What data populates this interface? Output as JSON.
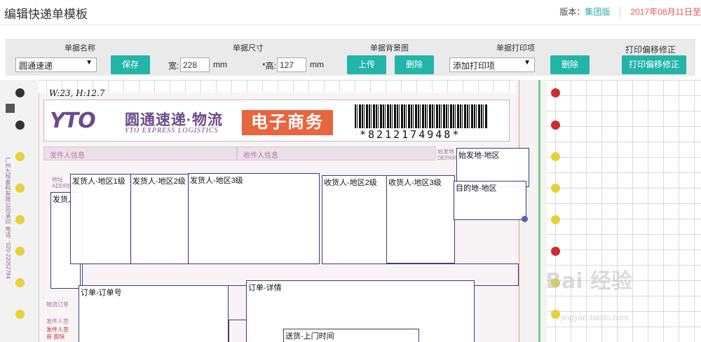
{
  "header": {
    "title": "编辑快递单模板",
    "version_label": "版本：",
    "version_value": "集团版",
    "date_year": "2017",
    "date_y_suffix": "年",
    "date_month": "08",
    "date_m_suffix": "月",
    "date_day": "11",
    "date_tail": "日至"
  },
  "toolbar": {
    "doc_name_caption": "单据名称",
    "doc_name_value": "圆通速递",
    "save_label": "保存",
    "size_caption": "单据尺寸",
    "width_label": "宽:",
    "width_value": "228",
    "width_unit": "mm",
    "height_label": "*高:",
    "height_value": "127",
    "height_unit": "mm",
    "bg_caption": "单据背景图",
    "upload_label": "上传",
    "delete_bg_label": "删除",
    "print_items_caption": "单据打印项",
    "print_item_value": "添加打印项",
    "delete_item_label": "删除",
    "offset_caption": "打印偏移修正",
    "offset_label": "打印偏移修正"
  },
  "waybill": {
    "handwritten_note": "W:23, H:12.7",
    "brand_logo": "YTO",
    "brand_cn": "圆通速递·物流",
    "brand_en": "YTO EXPRESS LOGISTICS",
    "ecommerce": "电子商务",
    "barcode_number": "*8212174948*",
    "sender_section": "发件人信息",
    "receiver_section": "收件人信息",
    "address_label": "地址 ADDRESS",
    "origin_label": "始发地 DEPART",
    "phone_vertical": "广州九恒泰科有限公司承印  电话：020-22052784",
    "logistics_label": "物流订单",
    "sender_sign": "发件人签",
    "sender_sign2": "发件人签",
    "wuliu": "音 面快"
  },
  "print_items": [
    {
      "label": "发货人-地区1级"
    },
    {
      "label": "发货人-地区2级"
    },
    {
      "label": "发货人-地区3级"
    },
    {
      "label": "收货人-地区2级"
    },
    {
      "label": "收货人-地区3级"
    },
    {
      "label": "始发地-地区"
    },
    {
      "label": "目的地-地区"
    },
    {
      "label": "发货人"
    },
    {
      "label": "订单-订单号"
    },
    {
      "label": "订单-详情"
    },
    {
      "label": "送货-上门时间"
    }
  ],
  "watermark": {
    "brand": "Bai 经验",
    "url": "jingyan.baidu.com"
  },
  "colors": {
    "accent": "#22b5a8",
    "date_red": "#e85c55",
    "brand_purple": "#6b4c8a",
    "ecommerce_orange": "#e8663f"
  }
}
